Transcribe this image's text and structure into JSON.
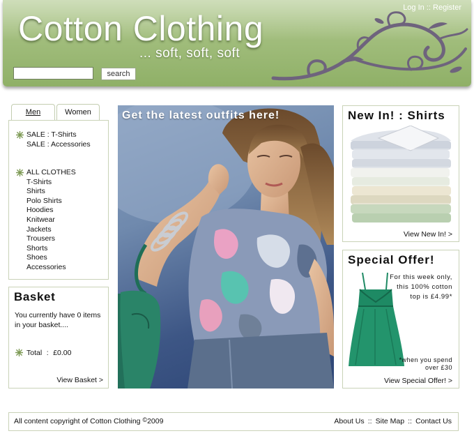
{
  "header": {
    "title": "Cotton Clothing",
    "tagline": "... soft, soft, soft",
    "login_label": "Log In",
    "auth_separator": "::",
    "register_label": "Register",
    "search_value": "",
    "search_button_label": "search",
    "colors": {
      "header_green": "#a1bd7c",
      "swirl": "#6e637d"
    }
  },
  "tabs": [
    {
      "label": "Men",
      "active": true
    },
    {
      "label": "Women",
      "active": false
    }
  ],
  "nav": {
    "sale_items": [
      "SALE : T-Shirts",
      "SALE : Accessories"
    ],
    "all_clothes_label": "ALL CLOTHES",
    "clothes_items": [
      "T-Shirts",
      "Shirts",
      "Polo Shirts",
      "Hoodies",
      "Knitwear",
      "Jackets",
      "Trousers",
      "Shorts",
      "Shoes",
      "Accessories"
    ],
    "bullet_icon": "leaf-icon"
  },
  "basket": {
    "title": "Basket",
    "message": "You currently have 0 items in your basket....",
    "total_label": "Total",
    "total_separator": ":",
    "total_value": "£0.00",
    "view_link": "View Basket >"
  },
  "hero": {
    "caption": "Get the latest outfits here!"
  },
  "new_in": {
    "title": "New In! : Shirts",
    "link": "View New In! >"
  },
  "special_offer": {
    "title": "Special Offer!",
    "text": "For this week only, this 100% cotton top is £4.99*",
    "note": "*when you spend over £30",
    "link": "View Special Offer! >",
    "product_color": "#1e8a64"
  },
  "footer": {
    "copyright_prefix": "All content copyright of Cotton Clothing",
    "copyright_symbol": "©",
    "copyright_year": "2009",
    "links": [
      "About Us",
      "Site Map",
      "Contact Us"
    ],
    "link_separator": "::"
  }
}
